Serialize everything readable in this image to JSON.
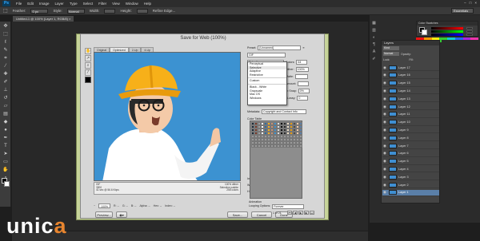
{
  "menubar": {
    "app": "Ps",
    "items": [
      "File",
      "Edit",
      "Image",
      "Layer",
      "Type",
      "Select",
      "Filter",
      "View",
      "Window",
      "Help"
    ]
  },
  "options": {
    "feather_label": "Feather:",
    "feather_value": "0 px",
    "style_label": "Style:",
    "style_value": "Normal",
    "width_label": "Width:",
    "height_label": "Height:",
    "refine": "Refine Edge...",
    "workspace": "Essentials"
  },
  "document_tab": "Untitled-1 @ 100% (Layer 1, RGB/8) ×",
  "dialog": {
    "title": "Save for Web (100%)",
    "tabs": [
      "Original",
      "Optimized",
      "2-Up",
      "4-Up"
    ],
    "info_left": [
      "GIF",
      "3900",
      "41 sec @ 56.6 Kbps"
    ],
    "info_right": [
      "100% dither",
      "Selective palette",
      "256 colors"
    ],
    "zoom_value": "100%",
    "r_label": "R: --",
    "g_label": "G: --",
    "b_label": "B: --",
    "alpha_label": "Alpha: --",
    "hex_label": "Hex: --",
    "index_label": "Index: --",
    "preview_button": "Preview...",
    "save_button": "Save...",
    "cancel_button": "Cancel",
    "done_button": "Done",
    "preset_label": "Preset:",
    "preset_value": "[Unnamed]",
    "format_value": "GIF",
    "reduction_value": "Selective",
    "colors_label": "Colors:",
    "colors_value": "64",
    "dither_label": "Dither:",
    "dither_value": "100%",
    "matte_label": "Matte:",
    "amount_label": "Amount:",
    "web_snap_label": "Web Snap:",
    "web_snap_value": "0%",
    "lossy_label": "Lossy:",
    "lossy_value": "0",
    "metadata_label": "Metadata:",
    "metadata_value": "Copyright and Contact Info",
    "color_table_label": "Color Table",
    "image_size_label": "Image Size",
    "w_label": "W:",
    "w_value": "960",
    "h_label": "H:",
    "h_value": "540",
    "percent_label": "Percent:",
    "percent_value": "100",
    "quality_label": "Quality:",
    "quality_value": "Bicubic",
    "animation_label": "Animation",
    "looping_label": "Looping Options:",
    "looping_value": "Forever",
    "frame_counter": "1 of 21",
    "dropdown_items": [
      "Perceptual",
      "Selective",
      "Adaptive",
      "Restrictive",
      "",
      "Custom",
      "",
      "Black - White",
      "Grayscale",
      "Mac OS",
      "Windows"
    ]
  },
  "layers": {
    "tabs": "Layers",
    "kind": "Kind",
    "mode": "Normal",
    "opacity_label": "Opacity:",
    "fill_label": "Fill:",
    "lock_label": "Lock:",
    "items": [
      "Layer 17",
      "Layer 16",
      "Layer 15",
      "Layer 14",
      "Layer 13",
      "Layer 12",
      "Layer 11",
      "Layer 10",
      "Layer 9",
      "Layer 8",
      "Layer 7",
      "Layer 6",
      "Layer 5",
      "Layer 4",
      "Layer 3",
      "Layer 2",
      "Layer 1"
    ],
    "selected": "Layer 1"
  },
  "color_panel": {
    "tabs": "Color   Swatches"
  },
  "watermark": {
    "left": "unic",
    "o": "a"
  },
  "colors": {
    "accent_blue": "#3c92d1",
    "dialog_frame": "#c7d49a",
    "brand_orange": "#e8852f"
  }
}
